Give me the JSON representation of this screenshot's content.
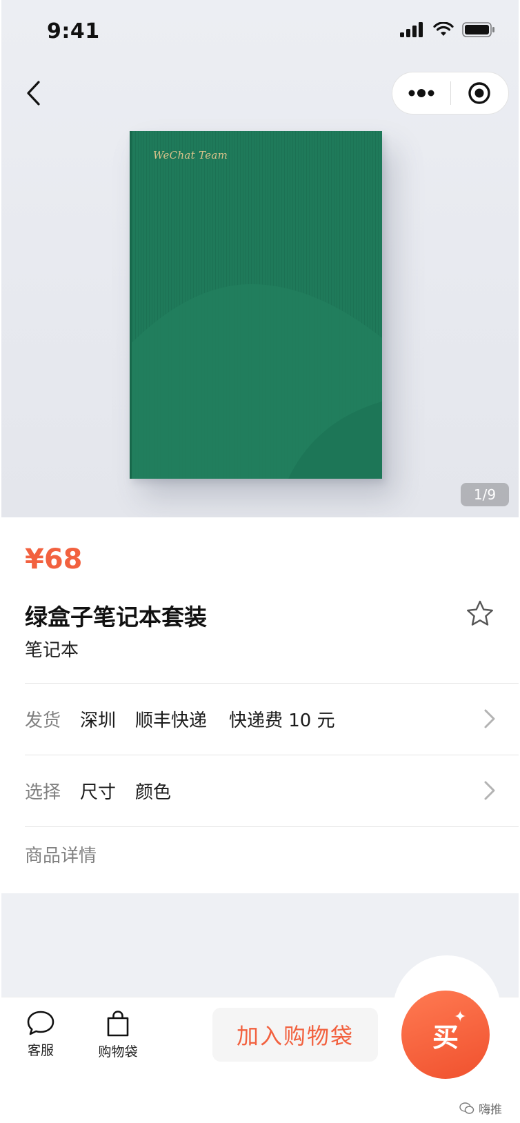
{
  "status_bar": {
    "time": "9:41"
  },
  "nav": {
    "back_icon": "chevron-left-icon",
    "more_icon": "more-dots-icon",
    "close_icon": "target-circle-icon"
  },
  "gallery": {
    "logo_text": "WeChat Team",
    "indicator": "1/9",
    "box_color": "#1f7a5a"
  },
  "product": {
    "price": "¥68",
    "name": "绿盒子笔记本套装",
    "category": "笔记本"
  },
  "shipping": {
    "label": "发货",
    "city": "深圳",
    "carrier": "顺丰快递",
    "fee": "快递费 10 元"
  },
  "options": {
    "label": "选择",
    "size": "尺寸",
    "color": "颜色"
  },
  "details": {
    "label": "商品详情"
  },
  "bottom_bar": {
    "service_label": "客服",
    "bag_label": "购物袋",
    "add_to_bag": "加入购物袋",
    "buy_label": "买"
  },
  "watermark": {
    "text": "嗨推"
  },
  "colors": {
    "accent": "#f2613f",
    "card": "#ffffff",
    "background": "#eef0f4"
  }
}
